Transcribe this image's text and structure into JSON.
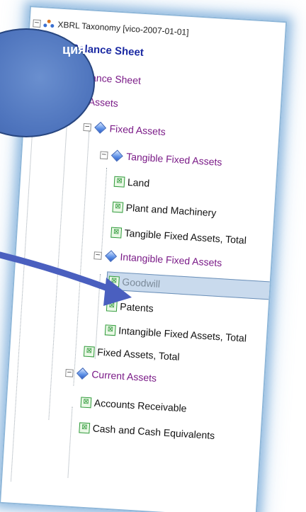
{
  "callout": {
    "text": "ция"
  },
  "tree": {
    "root": "XBRL Taxonomy [vico-2007-01-01]",
    "items": [
      {
        "label": "Balance Sheet",
        "kind": "bs"
      },
      {
        "label": "Balance Sheet",
        "kind": "bs2"
      },
      {
        "label": "Assets",
        "kind": "grp"
      },
      {
        "label": "Fixed Assets",
        "kind": "grp"
      },
      {
        "label": "Tangible Fixed Assets",
        "kind": "grp"
      },
      {
        "label": "Land",
        "kind": "leaf"
      },
      {
        "label": "Plant and Machinery",
        "kind": "leaf"
      },
      {
        "label": "Tangible Fixed Assets, Total",
        "kind": "leaf"
      },
      {
        "label": "Intangible Fixed Assets",
        "kind": "grp"
      },
      {
        "label": "Goodwill",
        "kind": "leaf-selected"
      },
      {
        "label": "Patents",
        "kind": "leaf"
      },
      {
        "label": "Intangible Fixed Assets, Total",
        "kind": "leaf"
      },
      {
        "label": "Fixed Assets, Total",
        "kind": "leaf"
      },
      {
        "label": "Current Assets",
        "kind": "grp"
      },
      {
        "label": "Accounts Receivable",
        "kind": "leaf"
      },
      {
        "label": "Cash and Cash Equivalents",
        "kind": "leaf"
      }
    ]
  },
  "colors": {
    "panel_glow": "#5a96cd",
    "callout_fill": "#4e74bd",
    "group_text": "#7a1a87",
    "balance_sheet_text": "#1b2aa3",
    "selection_bg": "#c9daed",
    "leaf_icon": "#2f9a3a"
  },
  "icons": {
    "expander": "minus-expander-icon",
    "group": "blue-diamond-icon",
    "leaf": "green-x-box-icon",
    "root": "taxonomy-network-icon"
  }
}
